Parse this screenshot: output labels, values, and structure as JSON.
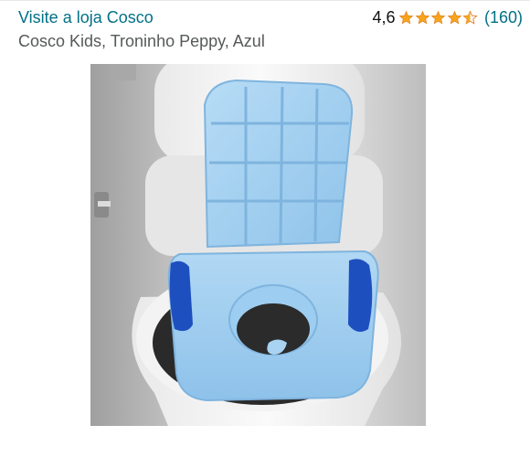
{
  "header": {
    "store_link": "Visite a loja Cosco",
    "rating_value": "4,6",
    "rating_stars": 4.6,
    "rating_count": "(160)"
  },
  "product": {
    "title": "Cosco Kids, Troninho Peppy, Azul"
  },
  "image": {
    "subject": "product-photo-potty-seat",
    "colors": {
      "seat_light_blue": "#a9d4f2",
      "handle_dark_blue": "#1e4fbf",
      "star_orange": "#f7a41d"
    }
  }
}
